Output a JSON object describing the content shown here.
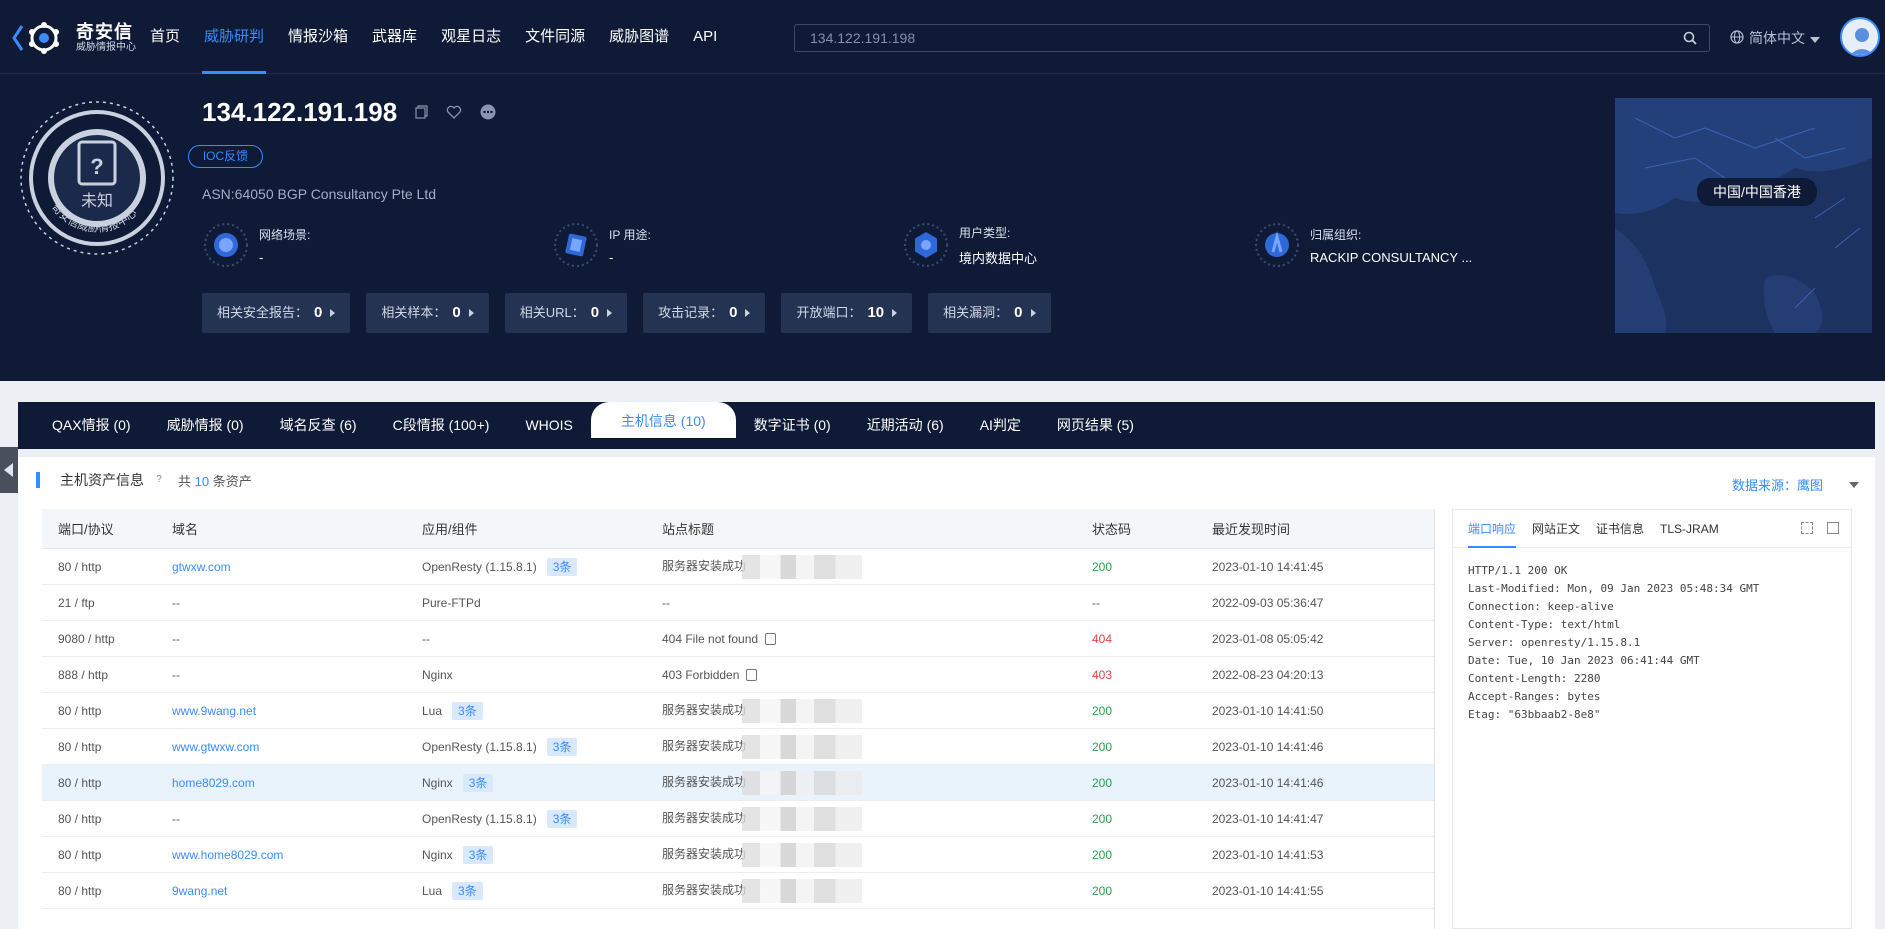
{
  "nav": {
    "logo_title": "奇安信",
    "logo_sub": "威胁情报中心",
    "menu": [
      "首页",
      "威胁研判",
      "情报沙箱",
      "武器库",
      "观星日志",
      "文件同源",
      "威胁图谱",
      "API"
    ],
    "active_menu": "威胁研判",
    "search_value": "134.122.191.198",
    "language": "简体中文"
  },
  "hero": {
    "badge_status": "未知",
    "badge_ring_text": "奇安信威胁情报中心",
    "ip": "134.122.191.198",
    "ioc_label": "IOC反馈",
    "asn": "ASN:64050 BGP Consultancy Pte Ltd",
    "info": [
      {
        "key": "网络场景:",
        "value": "-"
      },
      {
        "key": "IP 用途:",
        "value": "-"
      },
      {
        "key": "用户类型:",
        "value": "境内数据中心"
      },
      {
        "key": "归属组织:",
        "value": "RACKIP CONSULTANCY ..."
      }
    ],
    "stats": [
      {
        "label": "相关安全报告：",
        "value": "0"
      },
      {
        "label": "相关样本：",
        "value": "0"
      },
      {
        "label": "相关URL：",
        "value": "0"
      },
      {
        "label": "攻击记录：",
        "value": "0"
      },
      {
        "label": "开放端口：",
        "value": "10"
      },
      {
        "label": "相关漏洞：",
        "value": "0"
      }
    ],
    "map_location": "中国/中国香港"
  },
  "tabs": [
    "QAX情报 (0)",
    "威胁情报 (0)",
    "域名反查 (6)",
    "C段情报 (100+)",
    "WHOIS",
    "主机信息 (10)",
    "数字证书 (0)",
    "近期活动 (6)",
    "AI判定",
    "网页结果 (5)"
  ],
  "active_tab": "主机信息 (10)",
  "section": {
    "title": "主机资产信息",
    "help": "?",
    "count_prefix": "共",
    "count": "10",
    "count_suffix": "条资产",
    "source_label": "数据来源：",
    "source_value": "鹰图"
  },
  "table": {
    "headers": [
      "端口/协议",
      "域名",
      "应用/组件",
      "站点标题",
      "状态码",
      "最近发现时间"
    ],
    "rows": [
      {
        "port": "80 / http",
        "domain": "gtwxw.com",
        "app": "OpenResty (1.15.8.1)",
        "tag": "3条",
        "title": "服务器安装成功",
        "code": "200",
        "time": "2023-01-10 14:41:45"
      },
      {
        "port": "21 / ftp",
        "domain": "--",
        "app": "Pure-FTPd",
        "tag": "",
        "title": "--",
        "code": "--",
        "time": "2022-09-03 05:36:47"
      },
      {
        "port": "9080 / http",
        "domain": "--",
        "app": "--",
        "tag": "",
        "title": "404 File not found",
        "code": "404",
        "time": "2023-01-08 05:05:42"
      },
      {
        "port": "888 / http",
        "domain": "--",
        "app": "Nginx",
        "tag": "",
        "title": "403 Forbidden",
        "code": "403",
        "time": "2022-08-23 04:20:13"
      },
      {
        "port": "80 / http",
        "domain": "www.9wang.net",
        "app": "Lua",
        "tag": "3条",
        "title": "服务器安装成功",
        "code": "200",
        "time": "2023-01-10 14:41:50"
      },
      {
        "port": "80 / http",
        "domain": "www.gtwxw.com",
        "app": "OpenResty (1.15.8.1)",
        "tag": "3条",
        "title": "服务器安装成功",
        "code": "200",
        "time": "2023-01-10 14:41:46"
      },
      {
        "port": "80 / http",
        "domain": "home8029.com",
        "app": "Nginx",
        "tag": "3条",
        "title": "服务器安装成功",
        "code": "200",
        "time": "2023-01-10 14:41:46"
      },
      {
        "port": "80 / http",
        "domain": "--",
        "app": "OpenResty (1.15.8.1)",
        "tag": "3条",
        "title": "服务器安装成功",
        "code": "200",
        "time": "2023-01-10 14:41:47"
      },
      {
        "port": "80 / http",
        "domain": "www.home8029.com",
        "app": "Nginx",
        "tag": "3条",
        "title": "服务器安装成功",
        "code": "200",
        "time": "2023-01-10 14:41:53"
      },
      {
        "port": "80 / http",
        "domain": "9wang.net",
        "app": "Lua",
        "tag": "3条",
        "title": "服务器安装成功",
        "code": "200",
        "time": "2023-01-10 14:41:55"
      }
    ]
  },
  "response": {
    "tabs": [
      "端口响应",
      "网站正文",
      "证书信息",
      "TLS-JRAM"
    ],
    "active": "端口响应",
    "lines": [
      "HTTP/1.1 200 OK",
      "Last-Modified: Mon, 09 Jan 2023 05:48:34 GMT",
      "Connection: keep-alive",
      "Content-Type: text/html",
      "Server: openresty/1.15.8.1",
      "Date: Tue, 10 Jan 2023 06:41:44 GMT",
      "Content-Length: 2280",
      "Accept-Ranges: bytes",
      "Etag: \"63bbaab2-8e8\""
    ]
  },
  "colors": {
    "nav_bg": "#0e1a36",
    "accent": "#3a8bff",
    "ok": "#2e9d4d",
    "error": "#e04545"
  }
}
